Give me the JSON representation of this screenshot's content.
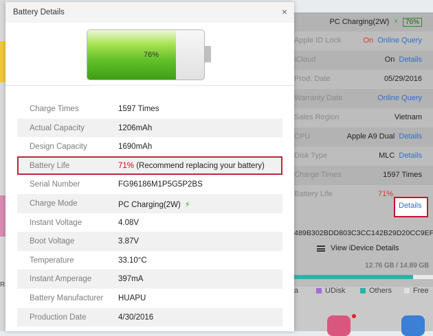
{
  "background_left": {
    "partial_text": "R"
  },
  "background_right": {
    "rows": [
      {
        "label": "",
        "value_parts": [
          {
            "text": "PC Charging(2W)"
          },
          {
            "text": "⚡",
            "style": "bolt"
          },
          {
            "text": "76%",
            "style": "pct"
          }
        ]
      },
      {
        "label": "Apple ID Lock",
        "value_parts": [
          {
            "text": "On",
            "style": "red"
          },
          {
            "text": "Online Query",
            "style": "blue"
          }
        ]
      },
      {
        "label": "iCloud",
        "value_parts": [
          {
            "text": "On"
          },
          {
            "text": "Details",
            "style": "blue"
          }
        ]
      },
      {
        "label": "Prod. Date",
        "value_parts": [
          {
            "text": "05/29/2016"
          }
        ]
      },
      {
        "label": "Warranty Date",
        "value_parts": [
          {
            "text": "Online Query",
            "style": "blue"
          }
        ]
      },
      {
        "label": "Sales Region",
        "value_parts": [
          {
            "text": "Vietnam"
          }
        ]
      },
      {
        "label": "CPU",
        "value_parts": [
          {
            "text": "Apple A9 Dual"
          },
          {
            "text": "Details",
            "style": "blue"
          }
        ]
      },
      {
        "label": "Disk Type",
        "value_parts": [
          {
            "text": "MLC"
          },
          {
            "text": "Details",
            "style": "blue"
          }
        ]
      },
      {
        "label": "Charge Times",
        "value_parts": [
          {
            "text": "1597 Times"
          }
        ]
      },
      {
        "label": "Battery Life",
        "value_parts": [
          {
            "text": "71%",
            "style": "red"
          }
        ]
      }
    ],
    "battery_details_link": "Details",
    "serial_partial": "489B302BDD803C3CC142B29D20CC9EF",
    "view_button": "View iDevice Details",
    "storage_text": "12.76 GB / 14.89 GB",
    "storage_fill": 0.857,
    "legend": [
      {
        "label": "a",
        "color": "#c9c9c9"
      },
      {
        "label": "UDisk",
        "color": "#a070d0"
      },
      {
        "label": "Others",
        "color": "#2bb3a6"
      },
      {
        "label": "Free",
        "color": "#e0e0e0"
      }
    ]
  },
  "modal": {
    "title": "Battery Details",
    "close_symbol": "×",
    "battery_level": 0.76,
    "battery_text": "76%",
    "rows": [
      {
        "label": "Charge Times",
        "value": "1597 Times"
      },
      {
        "label": "Actual Capacity",
        "value": "1206mAh"
      },
      {
        "label": "Design Capacity",
        "value": "1690mAh"
      },
      {
        "label": "Battery Life",
        "value_red": "71%",
        "value_rest": " (Recommend replacing your battery)",
        "highlight": true
      },
      {
        "label": "Serial Number",
        "value": "FG96186M1P5G5P2BS"
      },
      {
        "label": "Charge Mode",
        "value": "PC Charging(2W)",
        "bolt": "⚡"
      },
      {
        "label": "Instant Voltage",
        "value": "4.08V"
      },
      {
        "label": "Boot Voltage",
        "value": "3.87V"
      },
      {
        "label": "Temperature",
        "value": "33.10°C"
      },
      {
        "label": "Instant Amperage",
        "value": "397mA"
      },
      {
        "label": "Battery Manufacturer",
        "value": "HUAPU"
      },
      {
        "label": "Production Date",
        "value": "4/30/2016"
      }
    ]
  },
  "colors": {
    "accent_blue": "#2a6fcf",
    "warning_red": "#d0021b",
    "highlight_border": "#b8283a",
    "charge_green": "#34a830"
  }
}
